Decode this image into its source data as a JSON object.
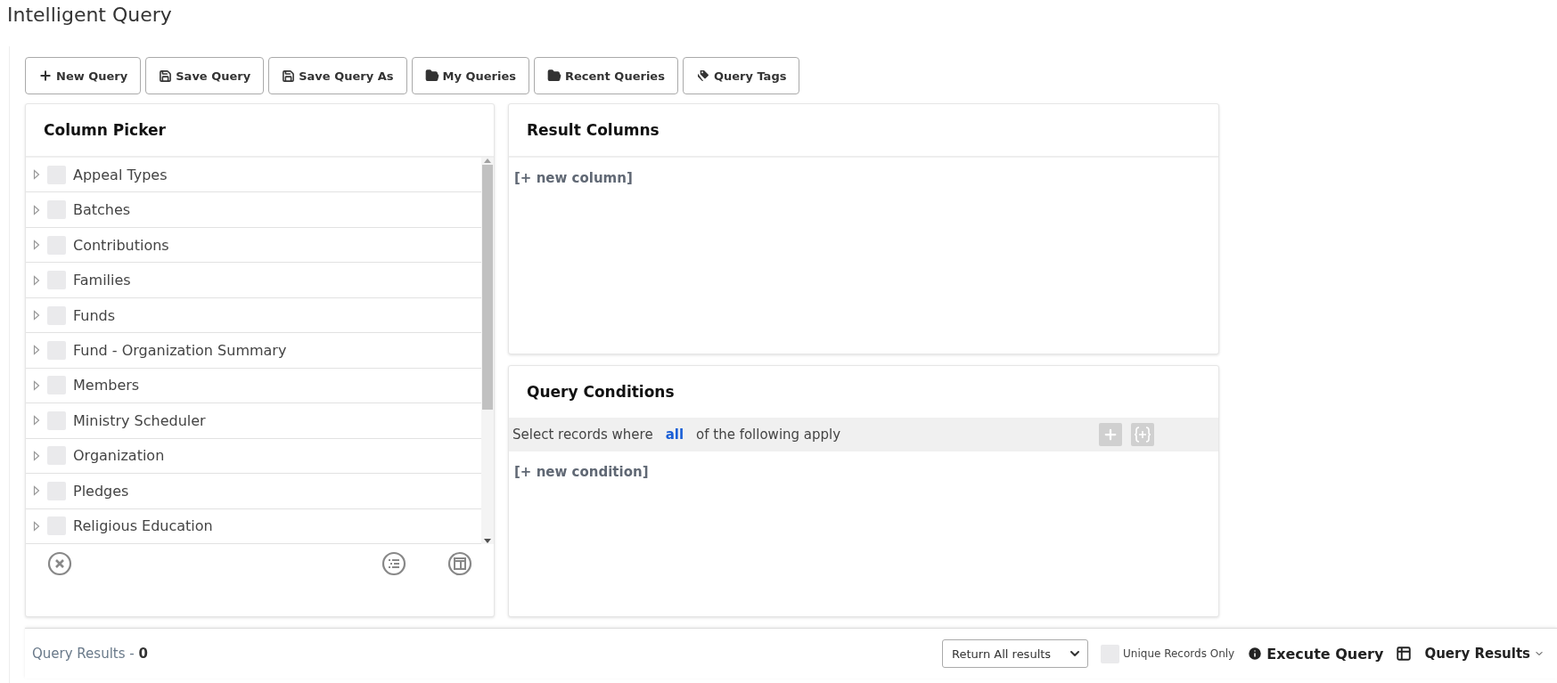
{
  "page_title": "Intelligent Query",
  "toolbar": [
    {
      "label": "New Query",
      "kind": "new"
    },
    {
      "label": "Save Query",
      "kind": "save"
    },
    {
      "label": "Save Query As",
      "kind": "save"
    },
    {
      "label": "My Queries",
      "kind": "folder"
    },
    {
      "label": "Recent Queries",
      "kind": "folder"
    },
    {
      "label": "Query Tags",
      "kind": "tags"
    }
  ],
  "column_picker": {
    "title": "Column Picker",
    "items": [
      {
        "label": "Appeal Types",
        "checked": false,
        "expanded": false
      },
      {
        "label": "Batches",
        "checked": false,
        "expanded": false
      },
      {
        "label": "Contributions",
        "checked": false,
        "expanded": false
      },
      {
        "label": "Families",
        "checked": false,
        "expanded": false
      },
      {
        "label": "Funds",
        "checked": false,
        "expanded": false
      },
      {
        "label": "Fund - Organization Summary",
        "checked": false,
        "expanded": false
      },
      {
        "label": "Members",
        "checked": false,
        "expanded": false
      },
      {
        "label": "Ministry Scheduler",
        "checked": false,
        "expanded": false
      },
      {
        "label": "Organization",
        "checked": false,
        "expanded": false
      },
      {
        "label": "Pledges",
        "checked": false,
        "expanded": false
      },
      {
        "label": "Religious Education",
        "checked": false,
        "expanded": false
      }
    ]
  },
  "result_columns": {
    "title": "Result Columns",
    "add_link": "[+ new column]"
  },
  "query_conditions": {
    "title": "Query Conditions",
    "sentence_before": "Select records where",
    "match": "all",
    "sentence_after": "of the following apply",
    "add_link": "[+ new condition]"
  },
  "results_bar": {
    "label": "Query Results - ",
    "count": "0",
    "return_select": {
      "value": "Return All results"
    },
    "unique_records": {
      "label": "Unique Records Only",
      "checked": false
    },
    "execute": "Execute Query",
    "results_menu": "Query Results"
  }
}
